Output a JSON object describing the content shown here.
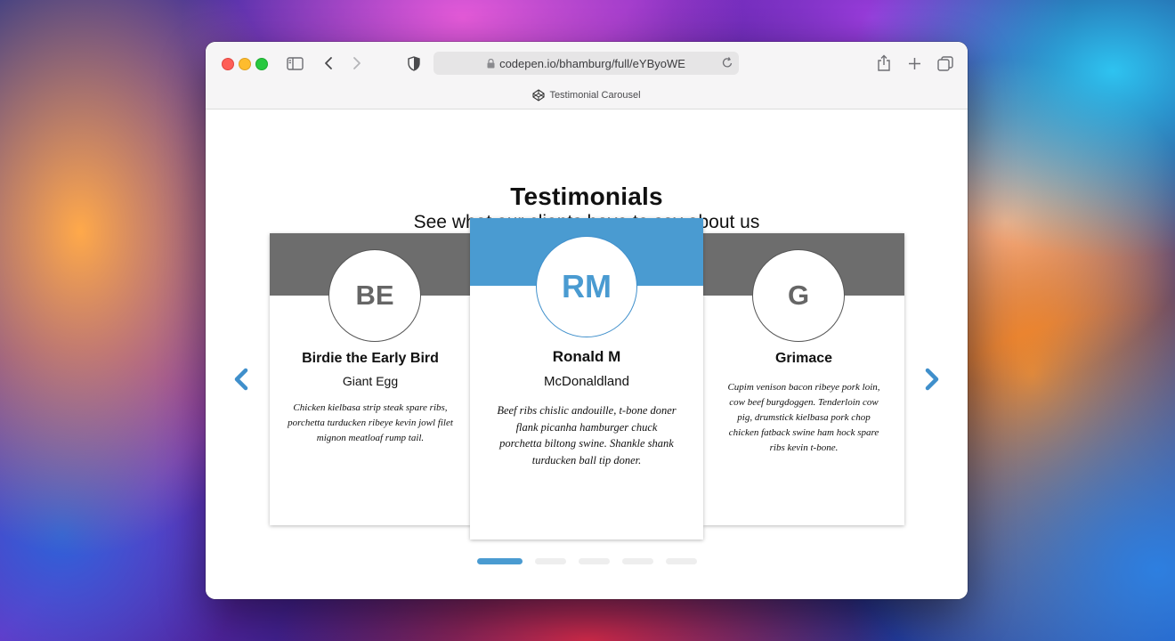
{
  "browser": {
    "url": "codepen.io/bhamburg/full/eYByoWE",
    "tab_title": "Testimonial Carousel"
  },
  "page": {
    "heading": "Testimonials",
    "subheading": "See what our clients have to say about us"
  },
  "testimonials": [
    {
      "initials": "BE",
      "name": "Birdie the Early Bird",
      "company": "Giant Egg",
      "quote": "Chicken kielbasa strip steak spare ribs, porchetta turducken ribeye kevin jowl filet mignon meatloaf rump tail."
    },
    {
      "initials": "RM",
      "name": "Ronald M",
      "company": "McDonaldland",
      "quote": "Beef ribs chislic andouille, t-bone doner flank picanha hamburger chuck porchetta biltong swine. Shankle shank turducken ball tip doner."
    },
    {
      "initials": "G",
      "name": "Grimace",
      "company": "",
      "quote": "Cupim venison bacon ribeye pork loin, cow beef burgdoggen. Tenderloin cow pig, drumstick kielbasa pork chop chicken fatback swine ham hock spare ribs kevin t-bone."
    }
  ],
  "carousel": {
    "slide_count": 5,
    "active_slide": 1
  },
  "colors": {
    "accent": "#4a9bd1",
    "side_band": "#6d6d6d"
  },
  "icons": {
    "prev": "chevron-left-icon",
    "next": "chevron-right-icon"
  }
}
